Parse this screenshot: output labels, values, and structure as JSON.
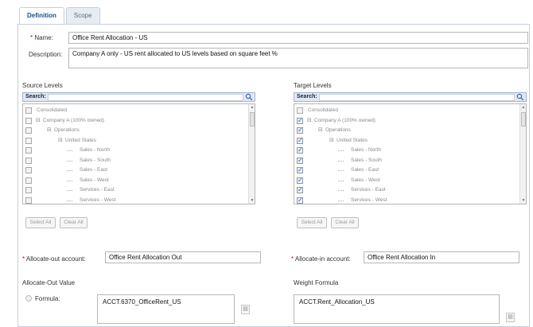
{
  "tabs": [
    {
      "label": "Definition",
      "active": true
    },
    {
      "label": "Scope",
      "active": false
    }
  ],
  "form": {
    "name_label": "Name:",
    "name_value": "Office Rent Allocation - US",
    "description_label": "Description:",
    "description_value": "Company A only - US rent allocated to US levels based on square feet %"
  },
  "source": {
    "title": "Source Levels",
    "search_label": "Search:",
    "rows": [
      {
        "label": "Consolidated",
        "checked": false
      },
      {
        "label": "Company A (100% owned)",
        "checked": false
      },
      {
        "label": "Operations",
        "checked": false
      },
      {
        "label": "United States",
        "checked": false
      },
      {
        "label": "Sales - North",
        "checked": false
      },
      {
        "label": "Sales - South",
        "checked": false
      },
      {
        "label": "Sales - East",
        "checked": false
      },
      {
        "label": "Sales - West",
        "checked": false
      },
      {
        "label": "Services - East",
        "checked": false
      },
      {
        "label": "Services - West",
        "checked": false
      }
    ],
    "select_all": "Select All",
    "clear_all": "Clear All"
  },
  "target": {
    "title": "Target Levels",
    "search_label": "Search:",
    "rows": [
      {
        "label": "Consolidated",
        "checked": false
      },
      {
        "label": "Company A (100% owned)",
        "checked": true
      },
      {
        "label": "Operations",
        "checked": true
      },
      {
        "label": "United States",
        "checked": true
      },
      {
        "label": "Sales - North",
        "checked": true
      },
      {
        "label": "Sales - South",
        "checked": true
      },
      {
        "label": "Sales - East",
        "checked": true
      },
      {
        "label": "Sales - West",
        "checked": true
      },
      {
        "label": "Services - East",
        "checked": true
      },
      {
        "label": "Services - West",
        "checked": true
      }
    ],
    "select_all": "Select All",
    "clear_all": "Clear All"
  },
  "allocate_out": {
    "label": "Allocate-out account:",
    "value": "Office Rent Allocation Out"
  },
  "allocate_in": {
    "label": "Allocate-in account:",
    "value": "Office Rent Allocation In"
  },
  "allocate_out_value": {
    "title": "Allocate-Out Value",
    "formula_label": "Formula:",
    "formula_value": "ACCT.6370_OfficeRent_US"
  },
  "weight_formula": {
    "title": "Weight Formula",
    "value": "ACCT.Rent_Allocation_US"
  },
  "required_mark": "*",
  "icons": {
    "search": "magnifier-icon",
    "expand": "plus-square-icon",
    "minus": "minus-square-icon"
  },
  "colors": {
    "accent": "#1d4f8c",
    "required": "#cc0000"
  }
}
